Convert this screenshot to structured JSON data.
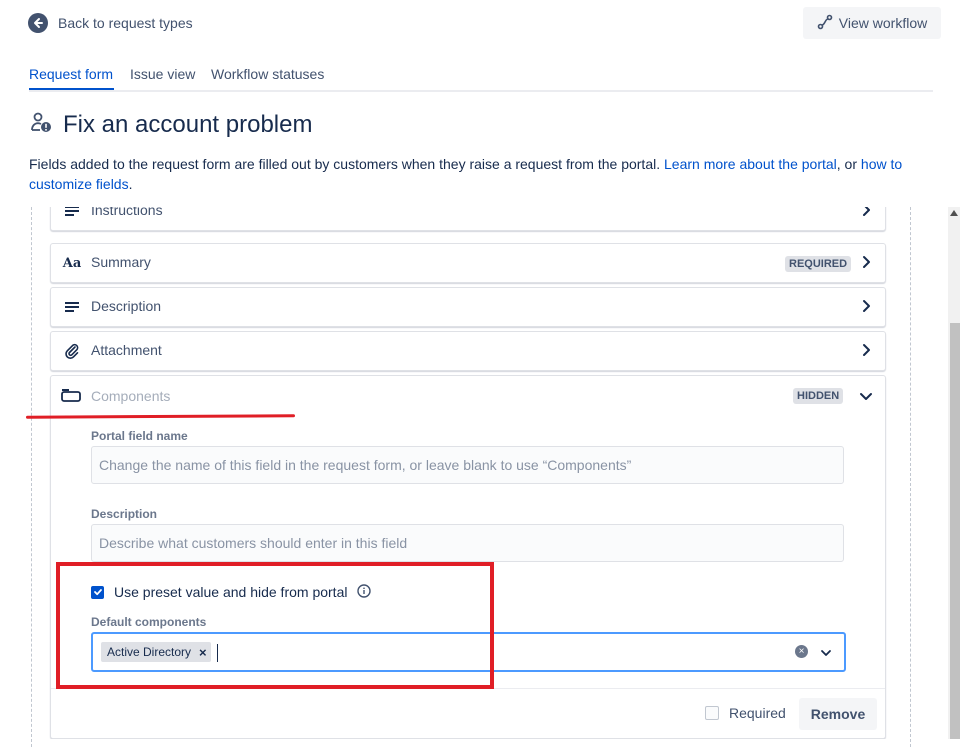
{
  "header": {
    "back_label": "Back to request types",
    "view_workflow_label": "View workflow"
  },
  "tabs": [
    {
      "label": "Request form",
      "active": true
    },
    {
      "label": "Issue view",
      "active": false
    },
    {
      "label": "Workflow statuses",
      "active": false
    }
  ],
  "page": {
    "title": "Fix an account problem",
    "description_text": "Fields added to the request form are filled out by customers when they raise a request from the portal. ",
    "learn_more_link": "Learn more about the portal",
    "separator": ", or ",
    "customize_link": "how to customize fields",
    "period": "."
  },
  "fields": [
    {
      "label": "Instructions",
      "icon": "text-lines-icon"
    },
    {
      "label": "Summary",
      "icon": "text-aa-icon",
      "badge": "REQUIRED"
    },
    {
      "label": "Description",
      "icon": "text-lines-icon"
    },
    {
      "label": "Attachment",
      "icon": "paperclip-icon"
    }
  ],
  "expanded_field": {
    "label": "Components",
    "icon": "component-icon",
    "badge": "HIDDEN",
    "portal_field_name_label": "Portal field name",
    "portal_field_name_placeholder": "Change the name of this field in the request form, or leave blank to use “Components”",
    "description_label": "Description",
    "description_placeholder": "Describe what customers should enter in this field",
    "preset_checkbox_label": "Use preset value and hide from portal",
    "preset_checked": true,
    "default_components_label": "Default components",
    "selected_components": [
      "Active Directory"
    ],
    "required_label": "Required",
    "required_checked": false,
    "remove_label": "Remove"
  },
  "colors": {
    "primary": "#0052cc",
    "text": "#172b4d",
    "subtle": "#42526e",
    "annotation_red": "#e01e26"
  }
}
